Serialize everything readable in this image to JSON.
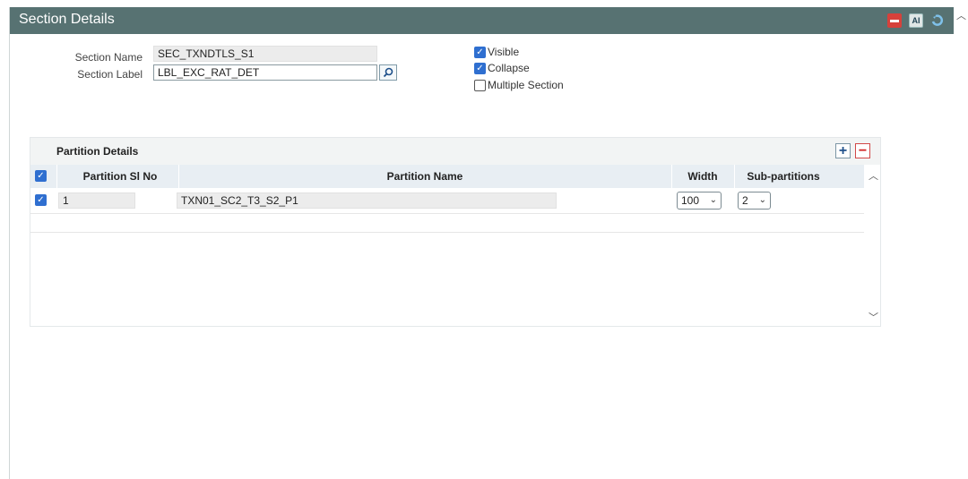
{
  "window": {
    "title": "Section Details",
    "buttons": {
      "minimize": "minimize",
      "help": "AI",
      "exit": "exit"
    }
  },
  "form": {
    "section_name": {
      "label": "Section Name",
      "value": "SEC_TXNDTLS_S1"
    },
    "section_label": {
      "label": "Section Label",
      "value": "LBL_EXC_RAT_DET"
    },
    "options": [
      {
        "label": "Visible",
        "checked": true
      },
      {
        "label": "Collapse",
        "checked": true
      },
      {
        "label": "Multiple Section",
        "checked": false
      }
    ]
  },
  "partition": {
    "title": "Partition Details",
    "columns": [
      "Partition Sl No",
      "Partition Name",
      "Width",
      "Sub-partitions"
    ],
    "rows": [
      {
        "checked": true,
        "sl_no": "1",
        "name": "TXN01_SC2_T3_S2_P1",
        "width": "100",
        "sub_partitions": "2"
      }
    ]
  },
  "colors": {
    "titlebar": "#577272",
    "checkbox": "#2f6fd0",
    "grid_header": "#e8eef3"
  }
}
